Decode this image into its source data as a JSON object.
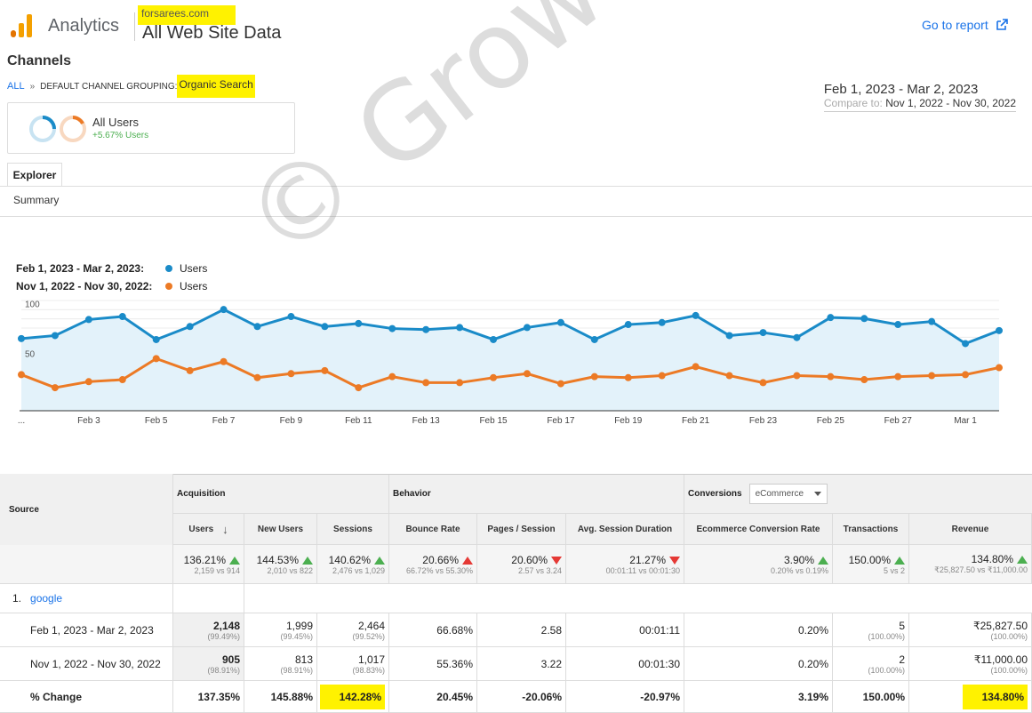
{
  "header": {
    "app_name": "Analytics",
    "account": "forsarees.com",
    "property": "All Web Site Data",
    "go_to_report": "Go to report"
  },
  "page": {
    "title": "Channels",
    "breadcrumb_all": "ALL",
    "breadcrumb_sep": "»",
    "breadcrumb_group": "DEFAULT CHANNEL GROUPING:",
    "breadcrumb_value": "Organic Search",
    "date_range": "Feb 1, 2023 - Mar 2, 2023",
    "compare_label": "Compare to:",
    "compare_range": "Nov 1, 2022 - Nov 30, 2022"
  },
  "segment": {
    "name": "All Users",
    "change": "+5.67% Users"
  },
  "tabs": {
    "explorer": "Explorer",
    "summary": "Summary"
  },
  "legend": {
    "range1": "Feb 1, 2023 - Mar 2, 2023:",
    "range2": "Nov 1, 2022 - Nov 30, 2022:",
    "metric1": "Users",
    "metric2": "Users"
  },
  "colors": {
    "series1": "#1a8bc8",
    "series2": "#ec7a25",
    "fill1": "#e3f2fa",
    "link": "#1a73e8",
    "highlight": "#fff200"
  },
  "chart_data": {
    "type": "line",
    "x_tick_labels": [
      "...",
      "Feb 3",
      "Feb 5",
      "Feb 7",
      "Feb 9",
      "Feb 11",
      "Feb 13",
      "Feb 15",
      "Feb 17",
      "Feb 19",
      "Feb 21",
      "Feb 23",
      "Feb 25",
      "Feb 27",
      "Mar 1"
    ],
    "y_tick_labels": [
      "100",
      "50"
    ],
    "ylim": [
      0,
      120
    ],
    "series": [
      {
        "name": "Users",
        "values": [
          72,
          75,
          91,
          94,
          71,
          84,
          101,
          84,
          94,
          84,
          87,
          82,
          81,
          83,
          71,
          83,
          88,
          71,
          86,
          88,
          95,
          75,
          78,
          73,
          93,
          92,
          86,
          89,
          67,
          80
        ]
      },
      {
        "name": "Users",
        "values": [
          36,
          23,
          29,
          31,
          52,
          40,
          49,
          33,
          37,
          40,
          23,
          34,
          28,
          28,
          33,
          37,
          27,
          34,
          33,
          35,
          44,
          35,
          28,
          35,
          34,
          31,
          34,
          35,
          36,
          43
        ]
      }
    ]
  },
  "table": {
    "source_label": "Source",
    "group_acquisition": "Acquisition",
    "group_behavior": "Behavior",
    "group_conversions": "Conversions",
    "conv_select": "eCommerce",
    "columns": [
      "Users",
      "New Users",
      "Sessions",
      "Bounce Rate",
      "Pages / Session",
      "Avg. Session Duration",
      "Ecommerce Conversion Rate",
      "Transactions",
      "Revenue"
    ],
    "totals": [
      {
        "value": "136.21%",
        "sub": "2,159 vs 914",
        "dir": "up"
      },
      {
        "value": "144.53%",
        "sub": "2,010 vs 822",
        "dir": "up"
      },
      {
        "value": "140.62%",
        "sub": "2,476 vs 1,029",
        "dir": "up"
      },
      {
        "value": "20.66%",
        "sub": "66.72% vs 55.30%",
        "dir": "upred"
      },
      {
        "value": "20.60%",
        "sub": "2.57 vs 3.24",
        "dir": "down"
      },
      {
        "value": "21.27%",
        "sub": "00:01:11 vs 00:01:30",
        "dir": "down"
      },
      {
        "value": "3.90%",
        "sub": "0.20% vs 0.19%",
        "dir": "up"
      },
      {
        "value": "150.00%",
        "sub": "5 vs 2",
        "dir": "up"
      },
      {
        "value": "134.80%",
        "sub": "₹25,827.50 vs ₹11,000.00",
        "dir": "up"
      }
    ],
    "row_index": "1.",
    "row_source": "google",
    "rows": [
      {
        "label": "Feb 1, 2023 - Mar 2, 2023",
        "cells": [
          {
            "v": "2,148",
            "s": "(99.49%)"
          },
          {
            "v": "1,999",
            "s": "(99.45%)"
          },
          {
            "v": "2,464",
            "s": "(99.52%)"
          },
          {
            "v": "66.68%",
            "s": ""
          },
          {
            "v": "2.58",
            "s": ""
          },
          {
            "v": "00:01:11",
            "s": ""
          },
          {
            "v": "0.20%",
            "s": ""
          },
          {
            "v": "5",
            "s": "(100.00%)"
          },
          {
            "v": "₹25,827.50",
            "s": "(100.00%)"
          }
        ]
      },
      {
        "label": "Nov 1, 2022 - Nov 30, 2022",
        "cells": [
          {
            "v": "905",
            "s": "(98.91%)"
          },
          {
            "v": "813",
            "s": "(98.91%)"
          },
          {
            "v": "1,017",
            "s": "(98.83%)"
          },
          {
            "v": "55.36%",
            "s": ""
          },
          {
            "v": "3.22",
            "s": ""
          },
          {
            "v": "00:01:30",
            "s": ""
          },
          {
            "v": "0.20%",
            "s": ""
          },
          {
            "v": "2",
            "s": "(100.00%)"
          },
          {
            "v": "₹11,000.00",
            "s": "(100.00%)"
          }
        ]
      }
    ],
    "change_label": "% Change",
    "change": [
      "137.35%",
      "145.88%",
      "142.28%",
      "20.45%",
      "-20.06%",
      "-20.97%",
      "3.19%",
      "150.00%",
      "134.80%"
    ]
  },
  "watermark": "© GrowthPOLIS"
}
